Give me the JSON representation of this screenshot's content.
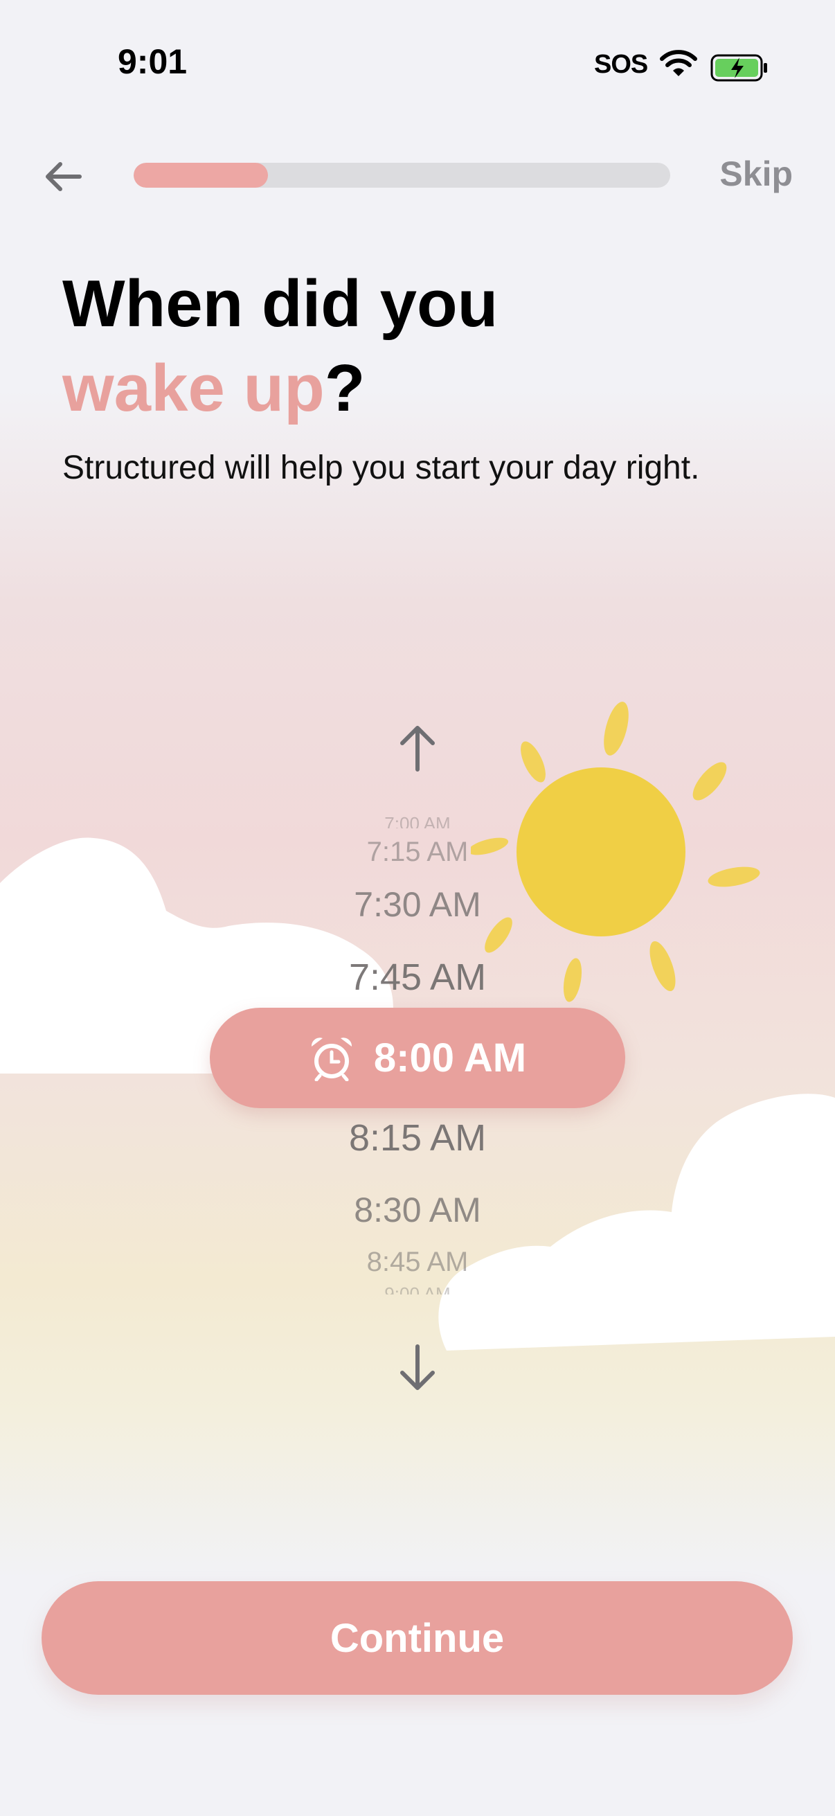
{
  "status_bar": {
    "time": "9:01",
    "carrier": "SOS",
    "wifi_icon": "wifi-icon",
    "battery_icon": "battery-charging-icon"
  },
  "header": {
    "back_icon": "arrow-left-icon",
    "progress": 0.25,
    "skip_label": "Skip"
  },
  "question": {
    "title_line1": "When did you",
    "title_accent": "wake up",
    "title_suffix": "?",
    "subtitle": "Structured will help you start your day right."
  },
  "time_picker": {
    "up_icon": "arrow-up-icon",
    "down_icon": "arrow-down-icon",
    "selected_icon": "alarm-clock-icon",
    "items_above": [
      "7:00 AM",
      "7:15 AM",
      "7:30 AM",
      "7:45 AM"
    ],
    "selected": "8:00 AM",
    "items_below": [
      "8:15 AM",
      "8:30 AM",
      "8:45 AM",
      "9:00 AM"
    ]
  },
  "decorations": {
    "sun": "sun-icon",
    "cloud": "cloud-icon"
  },
  "footer": {
    "continue_label": "Continue"
  },
  "colors": {
    "accent": "#e8a19d",
    "progress_track": "#dcdcdf",
    "background": "#f2f2f6",
    "sun": "#f0cf45"
  }
}
